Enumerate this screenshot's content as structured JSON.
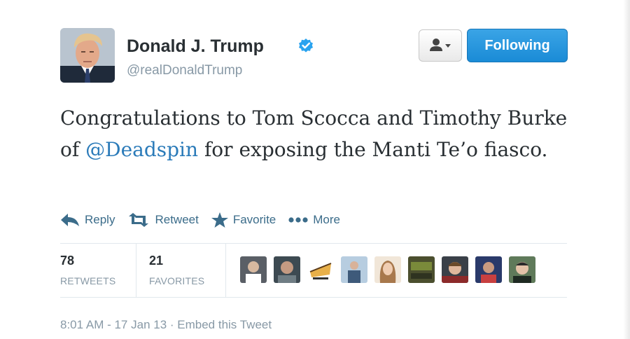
{
  "user": {
    "display_name": "Donald J. Trump",
    "handle": "@realDonaldTrump",
    "verified": true
  },
  "header_buttons": {
    "user_menu_icon": "person-icon",
    "follow_label": "Following"
  },
  "tweet": {
    "text_before": "Congratulations to Tom Scocca and Timothy Burke of ",
    "mention": "@Deadspin",
    "text_after": " for exposing the Manti Te’o fiasco."
  },
  "actions": [
    {
      "label": "Reply",
      "icon": "reply-icon"
    },
    {
      "label": "Retweet",
      "icon": "retweet-icon"
    },
    {
      "label": "Favorite",
      "icon": "star-icon"
    },
    {
      "label": "More",
      "icon": "more-dots-icon"
    }
  ],
  "stats": {
    "retweets_count": "78",
    "retweets_label": "RETWEETS",
    "favorites_count": "21",
    "favorites_label": "FAVORITES"
  },
  "footer": {
    "timestamp": "8:01 AM - 17 Jan 13",
    "separator": " · ",
    "embed_label": "Embed this Tweet"
  },
  "colors": {
    "link": "#2b7bb9",
    "follow_button": "#1a8bd6",
    "muted_text": "#8899a6",
    "action_color": "#3b6c8a"
  }
}
